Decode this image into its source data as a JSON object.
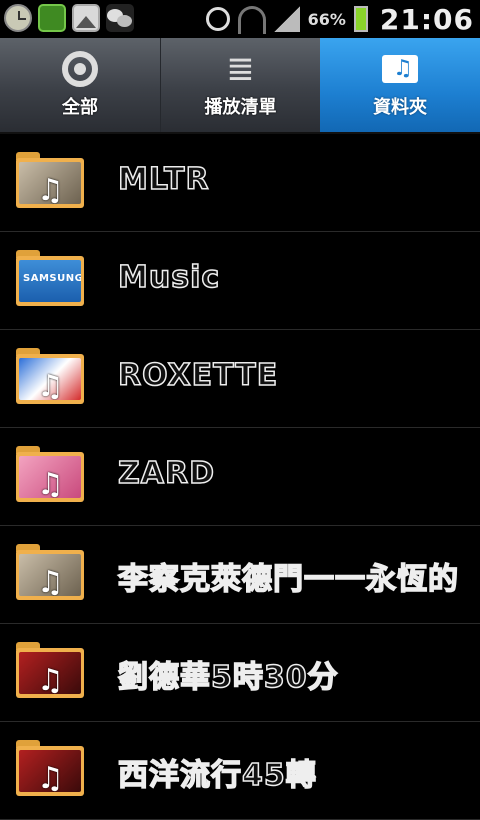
{
  "status_bar": {
    "battery_percent": "66%",
    "time": "21:06",
    "icons": [
      "clock-icon",
      "game-icon",
      "gallery-icon",
      "wechat-icon",
      "alarm-icon",
      "wifi-icon",
      "signal-icon",
      "battery-icon"
    ]
  },
  "tabs": [
    {
      "label": "全部",
      "icon": "disc-icon",
      "selected": false
    },
    {
      "label": "播放清單",
      "icon": "playlist-icon",
      "selected": false
    },
    {
      "label": "資料夾",
      "icon": "folder-music-icon",
      "selected": true
    }
  ],
  "folders": [
    {
      "name": "MLTR",
      "art": "gray"
    },
    {
      "name": "Music",
      "art": "samsung",
      "art_text": "SAMSUNG"
    },
    {
      "name": "ROXETTE",
      "art": "flag"
    },
    {
      "name": "ZARD",
      "art": "pink"
    },
    {
      "name": "李察克萊德門一一永恆的",
      "art": "gray"
    },
    {
      "name": "劉德華5時30分",
      "art": "red"
    },
    {
      "name": "西洋流行45轉",
      "art": "red"
    }
  ],
  "colors": {
    "accent": "#1d7fd1",
    "folder": "#f0b04c",
    "battery": "#8ad42b"
  }
}
